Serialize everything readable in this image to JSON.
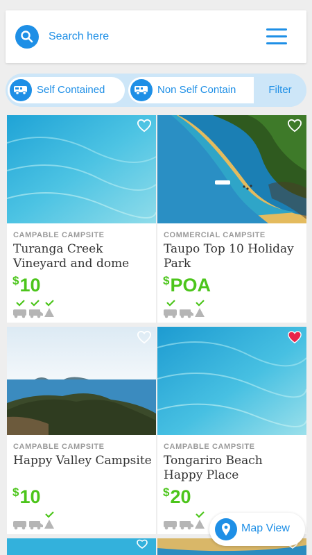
{
  "search": {
    "placeholder": "Search here",
    "icon": "search-icon"
  },
  "menu": {
    "icon": "hamburger-menu-icon"
  },
  "filters": {
    "chips": [
      {
        "label": "Self Contained",
        "icon": "campervan-icon"
      },
      {
        "label": "Non Self Contain",
        "icon": "campervan-icon"
      }
    ],
    "filter_label": "Filter"
  },
  "listings": [
    {
      "type": "CAMPABLE CAMPSITE",
      "name": "Turanga Creek Vineyard and dome",
      "currency": "$",
      "price": "10",
      "favorite": false,
      "amenities": {
        "campervan": true,
        "van": true,
        "tent": true
      }
    },
    {
      "type": "COMMERCIAL CAMPSITE",
      "name": "Taupo Top 10 Holiday Park",
      "currency": "$",
      "price": "POA",
      "favorite": false,
      "amenities": {
        "campervan": true,
        "van": false,
        "tent": true
      }
    },
    {
      "type": "CAMPABLE CAMPSITE",
      "name": "Happy Valley Campsite",
      "currency": "$",
      "price": "10",
      "favorite": false,
      "amenities": {
        "campervan": false,
        "van": false,
        "tent": true
      }
    },
    {
      "type": "CAMPABLE CAMPSITE",
      "name": "Tongariro Beach Happy Place",
      "currency": "$",
      "price": "20",
      "favorite": true,
      "amenities": {
        "campervan": false,
        "van": false,
        "tent": true
      }
    }
  ],
  "map_view": {
    "label": "Map View",
    "icon": "map-pin-icon"
  },
  "colors": {
    "accent": "#1e8fe6",
    "price": "#4cc51b",
    "favorite": "#e8244a",
    "chip_bg": "#cde6f8"
  }
}
